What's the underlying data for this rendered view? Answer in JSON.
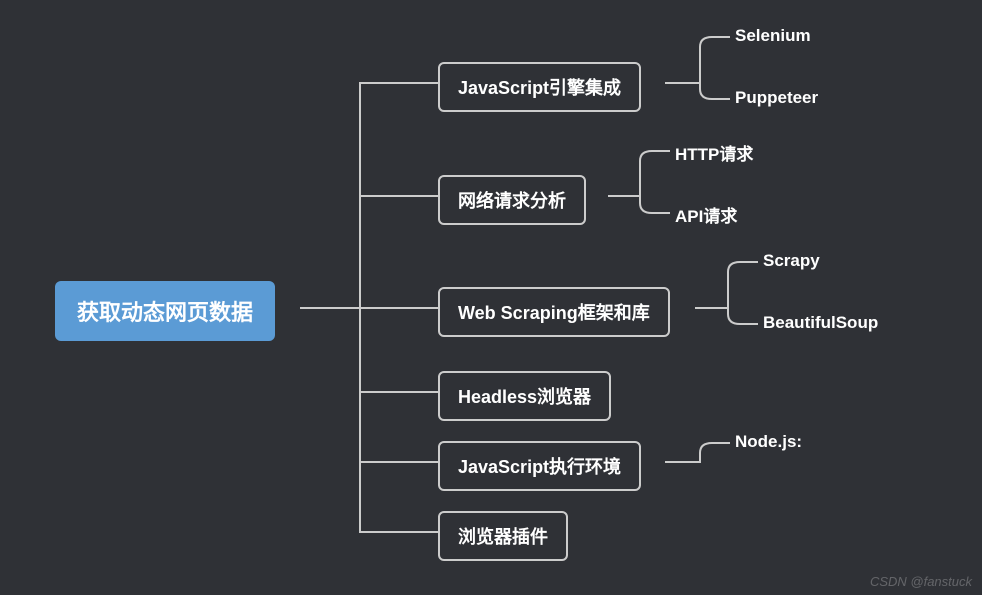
{
  "root": {
    "label": "获取动态网页数据"
  },
  "branches": [
    {
      "key": "b0",
      "label": "JavaScript引擎集成",
      "children": [
        {
          "key": "l00",
          "label": "Selenium"
        },
        {
          "key": "l01",
          "label": "Puppeteer"
        }
      ]
    },
    {
      "key": "b1",
      "label": "网络请求分析",
      "children": [
        {
          "key": "l10",
          "label": "HTTP请求"
        },
        {
          "key": "l11",
          "label": "API请求"
        }
      ]
    },
    {
      "key": "b2",
      "label": "Web Scraping框架和库",
      "children": [
        {
          "key": "l20",
          "label": "Scrapy"
        },
        {
          "key": "l21",
          "label": "BeautifulSoup"
        }
      ]
    },
    {
      "key": "b3",
      "label": "Headless浏览器",
      "children": []
    },
    {
      "key": "b4",
      "label": "JavaScript执行环境",
      "children": [
        {
          "key": "l40",
          "label": "Node.js:"
        }
      ]
    },
    {
      "key": "b5",
      "label": "浏览器插件",
      "children": []
    }
  ],
  "watermark": "CSDN @fanstuck"
}
